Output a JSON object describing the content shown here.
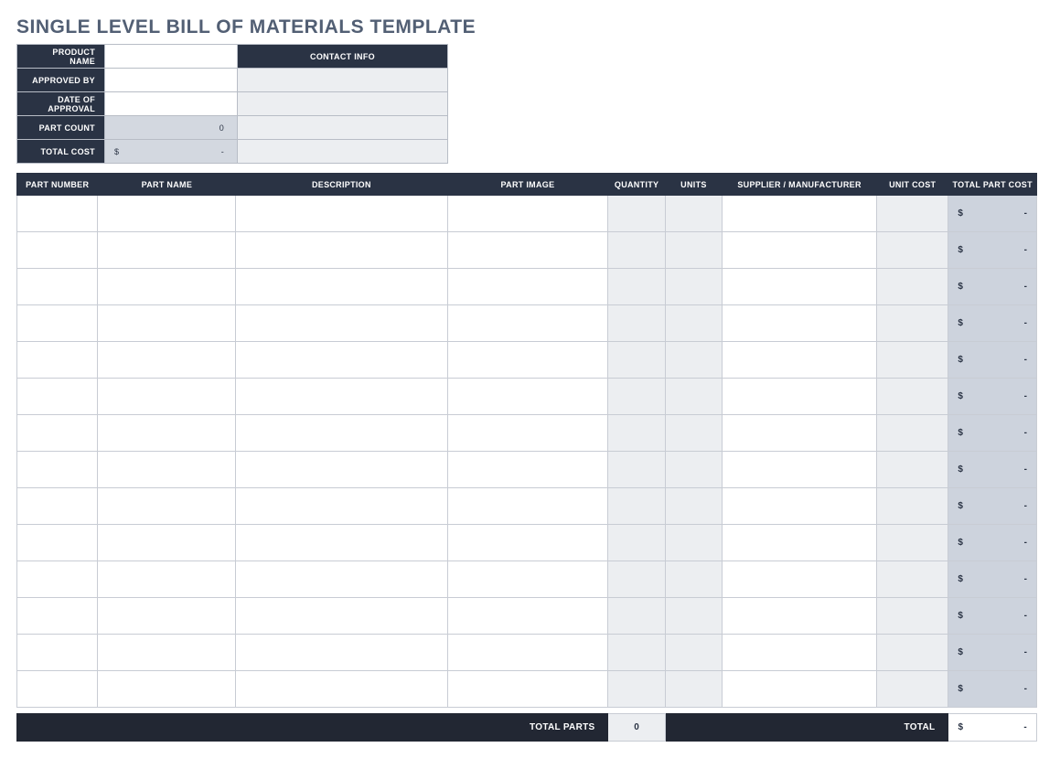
{
  "title": "SINGLE LEVEL BILL OF MATERIALS TEMPLATE",
  "info": {
    "labels": {
      "product_name": "PRODUCT NAME",
      "approved_by": "APPROVED BY",
      "date_of_approval": "DATE OF APPROVAL",
      "part_count": "PART COUNT",
      "total_cost": "TOTAL COST",
      "contact_info": "CONTACT INFO"
    },
    "values": {
      "product_name": "",
      "approved_by": "",
      "date_of_approval": "",
      "part_count": "0",
      "total_cost_currency": "$",
      "total_cost_amount": "-",
      "contact1": "",
      "contact2": "",
      "contact3": "",
      "contact4": ""
    }
  },
  "parts": {
    "headers": {
      "part_number": "PART NUMBER",
      "part_name": "PART NAME",
      "description": "DESCRIPTION",
      "part_image": "PART IMAGE",
      "quantity": "QUANTITY",
      "units": "UNITS",
      "supplier": "SUPPLIER / MANUFACTURER",
      "unit_cost": "UNIT COST",
      "total_part_cost": "TOTAL PART COST"
    },
    "rows": [
      {
        "currency": "$",
        "amount": "-"
      },
      {
        "currency": "$",
        "amount": "-"
      },
      {
        "currency": "$",
        "amount": "-"
      },
      {
        "currency": "$",
        "amount": "-"
      },
      {
        "currency": "$",
        "amount": "-"
      },
      {
        "currency": "$",
        "amount": "-"
      },
      {
        "currency": "$",
        "amount": "-"
      },
      {
        "currency": "$",
        "amount": "-"
      },
      {
        "currency": "$",
        "amount": "-"
      },
      {
        "currency": "$",
        "amount": "-"
      },
      {
        "currency": "$",
        "amount": "-"
      },
      {
        "currency": "$",
        "amount": "-"
      },
      {
        "currency": "$",
        "amount": "-"
      },
      {
        "currency": "$",
        "amount": "-"
      }
    ]
  },
  "footer": {
    "total_parts_label": "TOTAL PARTS",
    "total_parts_value": "0",
    "total_label": "TOTAL",
    "total_currency": "$",
    "total_amount": "-"
  }
}
